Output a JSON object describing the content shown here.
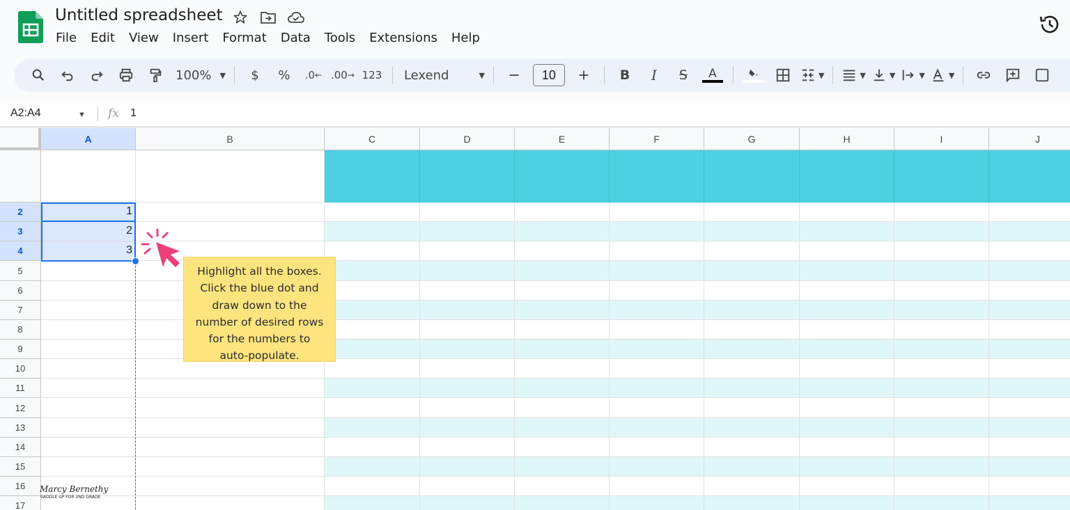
{
  "app": {
    "doc_title": "Untitled spreadsheet",
    "menu": [
      "File",
      "Edit",
      "View",
      "Insert",
      "Format",
      "Data",
      "Tools",
      "Extensions",
      "Help"
    ],
    "title_icons": [
      "star-icon",
      "move-to-folder-icon",
      "cloud-saved-icon"
    ],
    "history_icon": "version-history-icon",
    "brand_color": "#0f9d58"
  },
  "toolbar": {
    "zoom": "100%",
    "currency": "$",
    "percent": "%",
    "decrease_decimal": ".0",
    "increase_decimal": ".00",
    "more_formats": "123",
    "font": "Lexend",
    "font_size": "10",
    "text_color": "#000000",
    "icons": [
      "search-icon",
      "undo-icon",
      "redo-icon",
      "print-icon",
      "paint-format-icon",
      "bold-icon",
      "italic-icon",
      "strikethrough-icon",
      "text-color-icon",
      "fill-color-icon",
      "borders-icon",
      "merge-cells-icon",
      "horizontal-align-icon",
      "vertical-align-icon",
      "text-wrap-icon",
      "text-rotation-icon",
      "link-icon",
      "comment-icon"
    ]
  },
  "formula_bar": {
    "name_box": "A2:A4",
    "fx_label": "fx",
    "value": "1"
  },
  "sheet": {
    "columns": [
      "A",
      "B",
      "C",
      "D",
      "E",
      "F",
      "G",
      "H",
      "I",
      "J"
    ],
    "rows": [
      "2",
      "3",
      "4",
      "5",
      "6",
      "7",
      "8",
      "9",
      "10",
      "11",
      "12",
      "13",
      "14",
      "15",
      "16",
      "17"
    ],
    "selected_range": "A2:A4",
    "cells": {
      "A2": "1",
      "A3": "2",
      "A4": "3"
    },
    "header_fill_color": "#4dd0e1",
    "band_color": "#e0f7fa"
  },
  "annotation": {
    "text_lines": [
      "Highlight all the boxes.",
      "Click the blue dot and",
      "draw down to the",
      "number of desired rows",
      "for the numbers to",
      "auto-populate."
    ],
    "callout_color": "#fde47f",
    "cursor_color": "#ec407a"
  },
  "watermark": {
    "name": "Marcy Bernethy",
    "tagline": "SADDLE UP FOR 2ND GRADE"
  }
}
